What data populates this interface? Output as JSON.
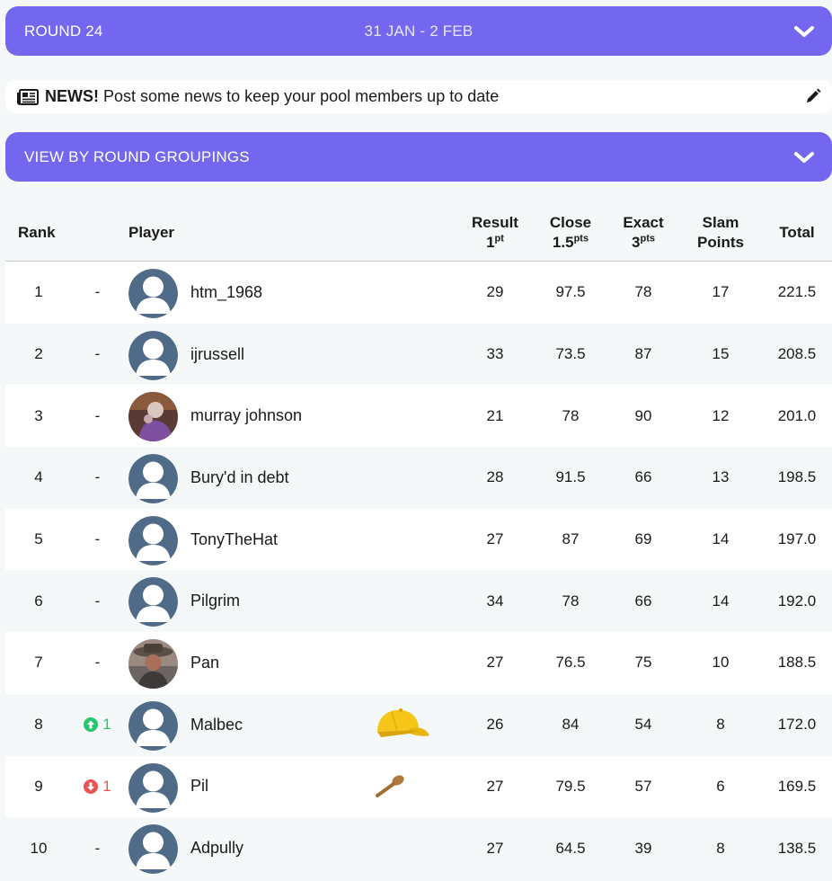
{
  "round_bar": {
    "round_label": "ROUND 24",
    "date_range": "31 JAN - 2 FEB"
  },
  "news": {
    "label": "NEWS!",
    "text": "Post some news to keep your pool members up to date"
  },
  "grouping_bar": {
    "label": "VIEW BY ROUND GROUPINGS"
  },
  "table": {
    "headers": {
      "rank": "Rank",
      "player": "Player",
      "result": "Result",
      "result_sub": "1",
      "result_unit": "pt",
      "close": "Close",
      "close_sub": "1.5",
      "close_unit": "pts",
      "exact": "Exact",
      "exact_sub": "3",
      "exact_unit": "pts",
      "slam1": "Slam",
      "slam2": "Points",
      "total": "Total"
    },
    "rows": [
      {
        "rank": "1",
        "move": "-",
        "move_dir": "none",
        "player": "htm_1968",
        "avatar": "default",
        "award": "",
        "result": "29",
        "close": "97.5",
        "exact": "78",
        "slam": "17",
        "total": "221.5"
      },
      {
        "rank": "2",
        "move": "-",
        "move_dir": "none",
        "player": "ijrussell",
        "avatar": "default",
        "award": "",
        "result": "33",
        "close": "73.5",
        "exact": "87",
        "slam": "15",
        "total": "208.5"
      },
      {
        "rank": "3",
        "move": "-",
        "move_dir": "none",
        "player": "murray johnson",
        "avatar": "photo-purple",
        "award": "",
        "result": "21",
        "close": "78",
        "exact": "90",
        "slam": "12",
        "total": "201.0"
      },
      {
        "rank": "4",
        "move": "-",
        "move_dir": "none",
        "player": "Bury'd in debt",
        "avatar": "default",
        "award": "",
        "result": "28",
        "close": "91.5",
        "exact": "66",
        "slam": "13",
        "total": "198.5"
      },
      {
        "rank": "5",
        "move": "-",
        "move_dir": "none",
        "player": "TonyTheHat",
        "avatar": "default",
        "award": "",
        "result": "27",
        "close": "87",
        "exact": "69",
        "slam": "14",
        "total": "197.0"
      },
      {
        "rank": "6",
        "move": "-",
        "move_dir": "none",
        "player": "Pilgrim",
        "avatar": "default",
        "award": "",
        "result": "34",
        "close": "78",
        "exact": "66",
        "slam": "14",
        "total": "192.0"
      },
      {
        "rank": "7",
        "move": "-",
        "move_dir": "none",
        "player": "Pan",
        "avatar": "photo-hat",
        "award": "",
        "result": "27",
        "close": "76.5",
        "exact": "75",
        "slam": "10",
        "total": "188.5"
      },
      {
        "rank": "8",
        "move": "1",
        "move_dir": "up",
        "player": "Malbec",
        "avatar": "default",
        "award": "yellow-cap-icon",
        "result": "26",
        "close": "84",
        "exact": "54",
        "slam": "8",
        "total": "172.0"
      },
      {
        "rank": "9",
        "move": "1",
        "move_dir": "down",
        "player": "Pil",
        "avatar": "default",
        "award": "wooden-spoon-icon",
        "result": "27",
        "close": "79.5",
        "exact": "57",
        "slam": "6",
        "total": "169.5"
      },
      {
        "rank": "10",
        "move": "-",
        "move_dir": "none",
        "player": "Adpully",
        "avatar": "default",
        "award": "",
        "result": "27",
        "close": "64.5",
        "exact": "39",
        "slam": "8",
        "total": "138.5"
      }
    ]
  },
  "colors": {
    "accent": "#7367f0",
    "up": "#28c76f",
    "down": "#ea5455",
    "avatar_default": "#4f6b87"
  }
}
